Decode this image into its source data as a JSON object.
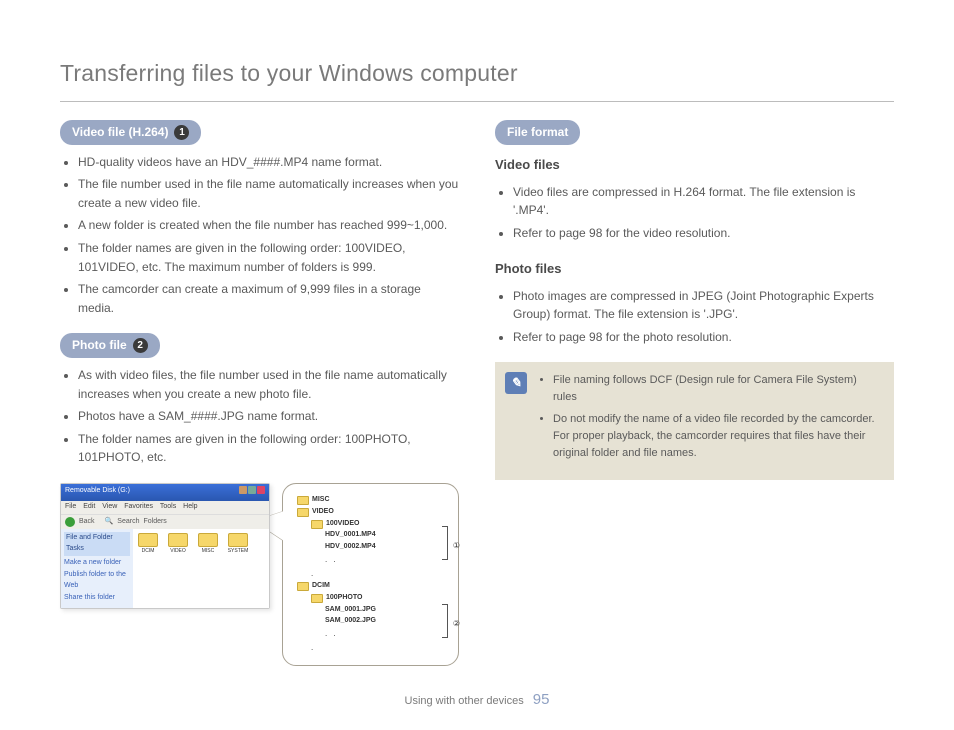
{
  "title": "Transferring files to your Windows computer",
  "left": {
    "pill1_label": "Video file (H.264)",
    "pill1_num": "1",
    "video_bullets": [
      "HD-quality videos have an HDV_####.MP4 name format.",
      "The file number used in the file name automatically increases when you create a new video file.",
      "A new folder is created when the file number has reached 999~1,000.",
      "The folder names are given in the following order: 100VIDEO, 101VIDEO, etc. The maximum number of folders  is 999.",
      "The camcorder can create a maximum of 9,999 files in a storage media."
    ],
    "pill2_label": "Photo file",
    "pill2_num": "2",
    "photo_bullets": [
      "As with video files, the file number used in the file name automatically increases when you create a new photo file.",
      "Photos have a SAM_####.JPG name format.",
      "The folder names are given in the following order: 100PHOTO, 101PHOTO, etc."
    ]
  },
  "explorer": {
    "title": "Removable Disk (G:)",
    "menu": [
      "File",
      "Edit",
      "View",
      "Favorites",
      "Tools",
      "Help"
    ],
    "tool_back": "Back",
    "tool_search": "Search",
    "tool_folders": "Folders",
    "side_head": "File and Folder Tasks",
    "side_items": [
      "Make a new folder",
      "Publish folder to the Web",
      "Share this folder"
    ],
    "folders": [
      "DCIM",
      "VIDEO",
      "MISC",
      "SYSTEM"
    ]
  },
  "tree": {
    "n0": "MISC",
    "n1": "VIDEO",
    "n1a": "100VIDEO",
    "n1a_f1": "HDV_0001.MP4",
    "n1a_f2": "HDV_0002.MP4",
    "n2": "DCIM",
    "n2a": "100PHOTO",
    "n2a_f1": "SAM_0001.JPG",
    "n2a_f2": "SAM_0002.JPG",
    "mark1": "①",
    "mark2": "②"
  },
  "right": {
    "pill_label": "File format",
    "sub1": "Video files",
    "sub1_bullets": [
      "Video files are compressed in H.264 format. The file extension is '.MP4'.",
      "Refer to page 98 for the video resolution."
    ],
    "sub2": "Photo files",
    "sub2_bullets": [
      "Photo images are compressed in JPEG (Joint Photographic Experts Group) format. The file extension is '.JPG'.",
      "Refer to page 98 for the photo resolution."
    ],
    "note_bullets": [
      "File naming follows DCF (Design rule for Camera File System) rules",
      "Do not modify the name of a video file recorded by the camcorder. For proper playback, the camcorder requires that files have their original folder and file names."
    ]
  },
  "footer_section": "Using with other devices",
  "footer_page": "95"
}
